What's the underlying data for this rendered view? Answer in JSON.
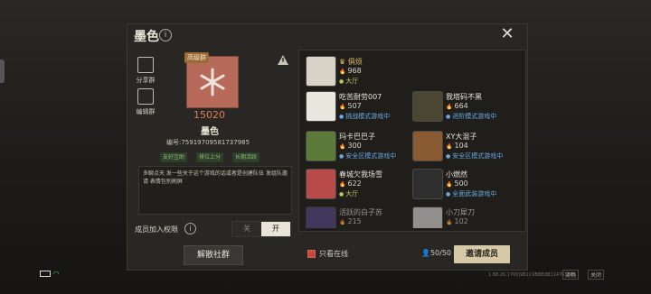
{
  "header": {
    "title": "墨色",
    "info_icon": "info-icon",
    "close_icon": "close-icon"
  },
  "sidebar_tools": [
    {
      "label": "分享群",
      "icon": "share-icon"
    },
    {
      "label": "编辑群",
      "icon": "edit-icon"
    }
  ],
  "group": {
    "badge": "高级群",
    "score": "15020",
    "name": "墨色",
    "id": "编号:75919709581737985",
    "tags": [
      "友好互助",
      "排位上分",
      "长期活跃"
    ],
    "description": "多聊点天 发一些关于这个游戏的话或者是创建队伍 发组队邀请   表情包别刷屏"
  },
  "permissions": {
    "label": "成员加入权限",
    "off": "关",
    "on": "开"
  },
  "dissolve_label": "解散社群",
  "members": [
    {
      "name": "俱烦",
      "hot": "968",
      "status": "大厅",
      "status_color": "green",
      "crown": true
    },
    {
      "name": "吃苦耐劳007",
      "hot": "507",
      "status": "挑战模式游戏中",
      "status_color": "blue"
    },
    {
      "name": "我塔码不黑",
      "hot": "664",
      "status": "进阶模式游戏中",
      "status_color": "blue"
    },
    {
      "name": "玛卡巴巴子",
      "hot": "300",
      "status": "安全区模式游戏中",
      "status_color": "blue"
    },
    {
      "name": "XY大混子",
      "hot": "104",
      "status": "安全区模式游戏中",
      "status_color": "blue"
    },
    {
      "name": "春城欠我场雪",
      "hot": "622",
      "status": "大厅",
      "status_color": "green"
    },
    {
      "name": "小燃然",
      "hot": "500",
      "status": "全面武装游戏中",
      "status_color": "blue"
    },
    {
      "name": "活跃的白子苏",
      "hot": "215",
      "status": "",
      "status_color": "blue"
    },
    {
      "name": "小刀犀刀",
      "hot": "102",
      "status": "",
      "status_color": "blue"
    }
  ],
  "footer": {
    "only_online": "只看在线",
    "count": "50/50",
    "invite": "邀请成员"
  },
  "system": {
    "version": "1.88.26.1700|9B1C9BBB3B11476166",
    "btn1": "流畅",
    "btn2": "关闭"
  },
  "colors": {
    "accent": "#e37b58",
    "invite_bg": "#d6c9a8",
    "status_blue": "#6aa8e0",
    "status_green": "#b8c860"
  }
}
